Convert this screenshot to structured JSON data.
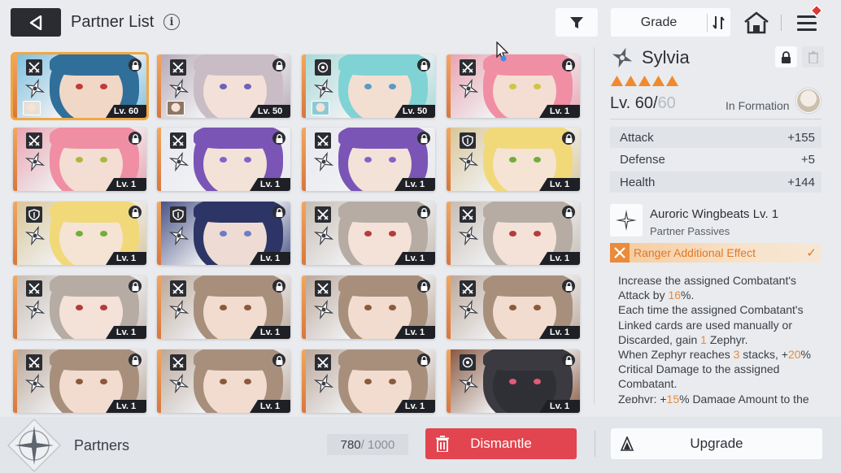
{
  "header": {
    "title": "Partner List",
    "info_icon": "info-icon",
    "grade_label": "Grade",
    "icons": [
      "back-arrow-icon",
      "filter-icon",
      "sort-icon",
      "home-icon",
      "menu-icon"
    ]
  },
  "partners": [
    {
      "level": "Lv. 60",
      "hair": "#2f6f9a",
      "skin": "#f1d7c6",
      "eye": "#c23a3a",
      "bg": "#7fc0e0",
      "cls": "crossed-swords-icon",
      "selected": true,
      "mini": "#e8e0d6"
    },
    {
      "level": "Lv. 50",
      "hair": "#c9bcc4",
      "skin": "#f3e0d8",
      "eye": "#6c62b8",
      "bg": "#b8aab6",
      "cls": "crossed-swords-icon",
      "mini": "#8f7663"
    },
    {
      "level": "Lv. 50",
      "hair": "#7fd3d4",
      "skin": "#f2dfd2",
      "eye": "#5b9ac4",
      "bg": "#a9d9d8",
      "cls": "target-icon",
      "mini": "#8cc9d6"
    },
    {
      "level": "Lv. 1",
      "hair": "#f08ea4",
      "skin": "#f4ddd2",
      "eye": "#d0c447",
      "bg": "#e9a4b1",
      "cls": "crossed-swords-icon"
    },
    {
      "level": "Lv. 1",
      "hair": "#f08ea4",
      "skin": "#f4ddd2",
      "eye": "#a9b93d",
      "bg": "#e9a4b1",
      "cls": "crossed-swords-icon"
    },
    {
      "level": "Lv. 1",
      "hair": "#7a55b6",
      "skin": "#f3e2d8",
      "eye": "#8860c8",
      "bg": "#e8e8f0",
      "cls": "crossed-swords-icon"
    },
    {
      "level": "Lv. 1",
      "hair": "#7a55b6",
      "skin": "#f3e2d8",
      "eye": "#8860c8",
      "bg": "#e8e8f0",
      "cls": "crossed-swords-icon"
    },
    {
      "level": "Lv. 1",
      "hair": "#f1d97a",
      "skin": "#f5e3d4",
      "eye": "#6fae3a",
      "bg": "#d9c79a",
      "cls": "shield-icon"
    },
    {
      "level": "Lv. 1",
      "hair": "#f1d97a",
      "skin": "#f5e3d4",
      "eye": "#6fae3a",
      "bg": "#d9c79a",
      "cls": "shield-icon"
    },
    {
      "level": "Lv. 1",
      "hair": "#2d3566",
      "skin": "#eddbd4",
      "eye": "#6b7cc8",
      "bg": "#4a5486",
      "cls": "shield-icon"
    },
    {
      "level": "Lv. 1",
      "hair": "#b6aca3",
      "skin": "#f4e1d7",
      "eye": "#b43c3c",
      "bg": "#c7bdb4",
      "cls": "crossed-swords-icon"
    },
    {
      "level": "Lv. 1",
      "hair": "#b6aca3",
      "skin": "#f4e1d7",
      "eye": "#b43c3c",
      "bg": "#c7bdb4",
      "cls": "crossed-swords-icon"
    },
    {
      "level": "Lv. 1",
      "hair": "#b6aca3",
      "skin": "#f4e1d7",
      "eye": "#b43c3c",
      "bg": "#c7bdb4",
      "cls": "crossed-swords-icon"
    },
    {
      "level": "Lv. 1",
      "hair": "#a88f7c",
      "skin": "#f1dccf",
      "eye": "#8b5a3a",
      "bg": "#bba89a",
      "cls": "crossed-swords-icon"
    },
    {
      "level": "Lv. 1",
      "hair": "#a88f7c",
      "skin": "#f1dccf",
      "eye": "#8b5a3a",
      "bg": "#bba89a",
      "cls": "crossed-swords-icon"
    },
    {
      "level": "Lv. 1",
      "hair": "#a88f7c",
      "skin": "#f1dccf",
      "eye": "#8b5a3a",
      "bg": "#bba89a",
      "cls": "crossed-swords-icon"
    },
    {
      "level": "Lv. 1",
      "hair": "#a88f7c",
      "skin": "#f1dccf",
      "eye": "#8b5a3a",
      "bg": "#bba89a",
      "cls": "crossed-swords-icon"
    },
    {
      "level": "Lv. 1",
      "hair": "#a88f7c",
      "skin": "#f1dccf",
      "eye": "#8b5a3a",
      "bg": "#bba89a",
      "cls": "crossed-swords-icon"
    },
    {
      "level": "Lv. 1",
      "hair": "#a88f7c",
      "skin": "#f1dccf",
      "eye": "#8b5a3a",
      "bg": "#bba89a",
      "cls": "crossed-swords-icon"
    },
    {
      "level": "Lv. 1",
      "hair": "#3a3a40",
      "skin": "#2f3035",
      "eye": "#e45a7a",
      "bg": "#8a5a44",
      "cls": "target-icon"
    }
  ],
  "detail": {
    "name": "Sylvia",
    "stars": 5,
    "level_current": "Lv. 60/",
    "level_max": "60",
    "in_formation": "In Formation",
    "stats": [
      {
        "label": "Attack",
        "value": "+155"
      },
      {
        "label": "Defense",
        "value": "+5"
      },
      {
        "label": "Health",
        "value": "+144"
      }
    ],
    "passive_name": "Auroric Wingbeats Lv. 1",
    "passive_sub": "Partner Passives",
    "effect_label": "Ranger Additional Effect",
    "desc": [
      [
        {
          "t": "Increase the assigned Combatant's Attack by "
        },
        {
          "t": "16",
          "hl": true
        },
        {
          "t": "%."
        }
      ],
      [
        {
          "t": "Each time the assigned Combatant's Linked cards are used manually or Discarded, gain "
        },
        {
          "t": "1",
          "hl": true
        },
        {
          "t": " Zephyr."
        }
      ],
      [
        {
          "t": "When Zephyr reaches "
        },
        {
          "t": "3",
          "hl": true
        },
        {
          "t": " stacks, +"
        },
        {
          "t": "20",
          "hl": true
        },
        {
          "t": "% Critical Damage to the assigned Combatant."
        }
      ],
      [
        {
          "t": "Zephyr: +"
        },
        {
          "t": "15",
          "hl": true
        },
        {
          "t": "% Damage Amount to the assigned Combatant's Passive Attack"
        }
      ]
    ]
  },
  "footer": {
    "partners_label": "Partners",
    "count_current": "780",
    "count_max": " / 1000",
    "dismantle_label": "Dismantle",
    "upgrade_label": "Upgrade"
  },
  "colors": {
    "accent": "#e98b3a",
    "dismantle": "#e2454f",
    "selected_outline": "#f0a842"
  }
}
